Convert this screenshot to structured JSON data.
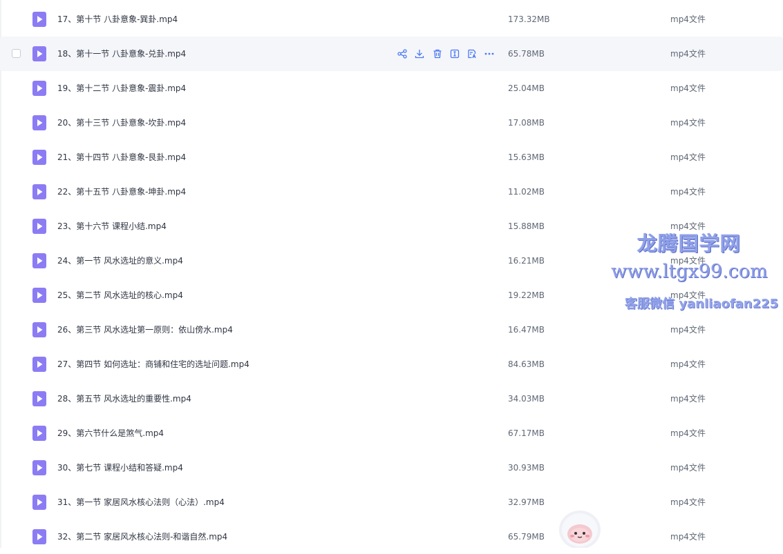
{
  "files": [
    {
      "name": "17、第十节 八卦意象-巽卦.mp4",
      "size": "173.32MB",
      "type": "mp4文件"
    },
    {
      "name": "18、第十一节 八卦意象-兑卦.mp4",
      "size": "65.78MB",
      "type": "mp4文件"
    },
    {
      "name": "19、第十二节 八卦意象-震卦.mp4",
      "size": "25.04MB",
      "type": "mp4文件"
    },
    {
      "name": "20、第十三节 八卦意象-坎卦.mp4",
      "size": "17.08MB",
      "type": "mp4文件"
    },
    {
      "name": "21、第十四节 八卦意象-艮卦.mp4",
      "size": "15.63MB",
      "type": "mp4文件"
    },
    {
      "name": "22、第十五节 八卦意象-坤卦.mp4",
      "size": "11.02MB",
      "type": "mp4文件"
    },
    {
      "name": "23、第十六节 课程小结.mp4",
      "size": "15.88MB",
      "type": "mp4文件"
    },
    {
      "name": "24、第一节 风水选址的意义.mp4",
      "size": "16.21MB",
      "type": "mp4文件"
    },
    {
      "name": "25、第二节 风水选址的核心.mp4",
      "size": "19.22MB",
      "type": "mp4文件"
    },
    {
      "name": "26、第三节 风水选址第一原则：依山傍水.mp4",
      "size": "16.47MB",
      "type": "mp4文件"
    },
    {
      "name": "27、第四节 如何选址：商铺和住宅的选址问题.mp4",
      "size": "84.63MB",
      "type": "mp4文件"
    },
    {
      "name": "28、第五节 风水选址的重要性.mp4",
      "size": "34.03MB",
      "type": "mp4文件"
    },
    {
      "name": "29、第六节什么是煞气.mp4",
      "size": "67.17MB",
      "type": "mp4文件"
    },
    {
      "name": "30、第七节 课程小结和答疑.mp4",
      "size": "30.93MB",
      "type": "mp4文件"
    },
    {
      "name": "31、第一节 家居风水核心法则（心法）.mp4",
      "size": "32.97MB",
      "type": "mp4文件"
    },
    {
      "name": "32、第二节 家居风水核心法则-和谐自然.mp4",
      "size": "65.79MB",
      "type": "mp4文件"
    }
  ],
  "hovered_row_index": 1,
  "row_actions": [
    "share-icon",
    "download-icon",
    "delete-icon",
    "rename-icon",
    "transcribe-icon",
    "more-icon"
  ],
  "watermark": {
    "title": "龙腾国学网",
    "site": "www.ltgx99.com",
    "contact": "客服微信 yanliaofan225"
  },
  "colors": {
    "accent": "#4a78f5",
    "file_icon": "#8c7cf4",
    "hover_bg": "#f5f6fa"
  }
}
